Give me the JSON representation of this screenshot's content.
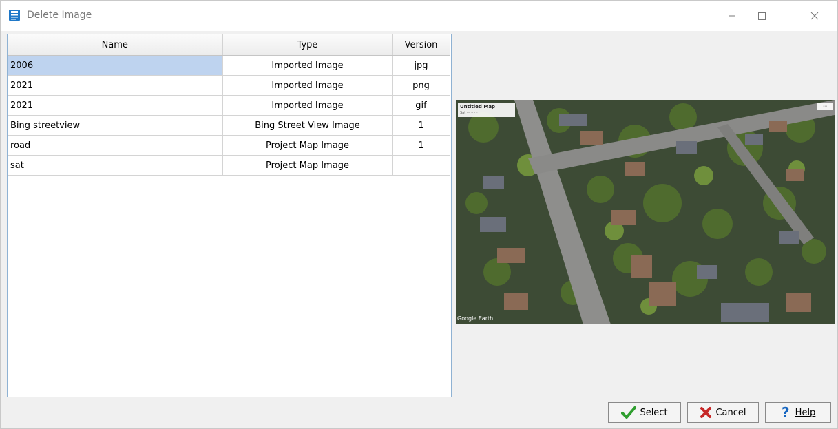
{
  "window": {
    "title": "Delete Image",
    "controls": [
      "minimize",
      "maximize",
      "close"
    ]
  },
  "table": {
    "columns": [
      "Name",
      "Type",
      "Version"
    ],
    "rows": [
      {
        "name": "2006",
        "type": "Imported Image",
        "version": "jpg",
        "selected": true
      },
      {
        "name": "2021",
        "type": "Imported Image",
        "version": "png",
        "selected": false
      },
      {
        "name": "2021",
        "type": "Imported Image",
        "version": "gif",
        "selected": false
      },
      {
        "name": "Bing streetview",
        "type": "Bing Street View Image",
        "version": "1",
        "selected": false
      },
      {
        "name": "road",
        "type": "Project Map Image",
        "version": "1",
        "selected": false
      },
      {
        "name": "sat",
        "type": "Project Map Image",
        "version": "",
        "selected": false
      }
    ]
  },
  "preview": {
    "overlay_title": "Untitled Map",
    "overlay_sub": "Sat ··· ·· ···",
    "corner_label": "⋯",
    "attribution": "Google Earth"
  },
  "buttons": {
    "select": "Select",
    "cancel": "Cancel",
    "help": "Help"
  },
  "colors": {
    "selected_row": "#bed3ef",
    "table_border": "#8fb2d3",
    "dialog_bg": "#f0f0f0"
  }
}
